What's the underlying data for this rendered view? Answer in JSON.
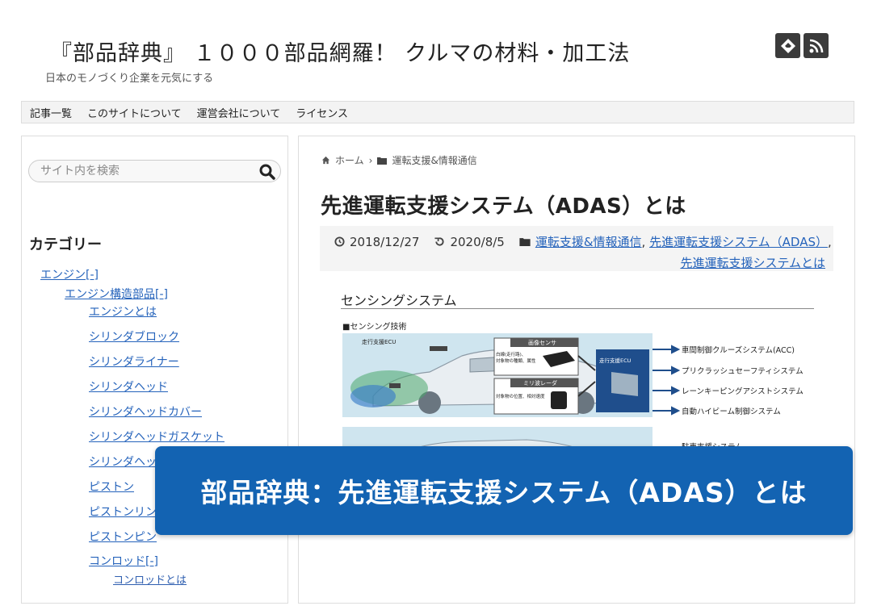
{
  "site": {
    "title": "『部品辞典』 １０００部品網羅！ クルマの材料・加工法",
    "description": "日本のモノづくり企業を元気にする"
  },
  "header_icons": [
    "feedly-icon",
    "rss-icon"
  ],
  "nav": [
    "記事一覧",
    "このサイトについて",
    "運営会社について",
    "ライセンス"
  ],
  "search": {
    "placeholder": "サイト内を検索"
  },
  "sidebar": {
    "category_title": "カテゴリー",
    "items": [
      "エンジン[-]",
      "エンジン構造部品[-]",
      "エンジンとは",
      "シリンダブロック",
      "シリンダライナー",
      "シリンダヘッド",
      "シリンダヘッドカバー",
      "シリンダヘッドガスケット",
      "シリンダヘッ",
      "ピストン",
      "ピストンリン",
      "ピストンピン",
      "コンロッド[-]",
      "コンロッドとは"
    ]
  },
  "breadcrumb": {
    "home": "ホーム",
    "separator": "›",
    "category": "運転支援&情報通信"
  },
  "article": {
    "title": "先進運転支援システム（ADAS）とは",
    "published": "2018/12/27",
    "updated": "2020/8/5",
    "categories": [
      "運転支援&情報通信",
      "先進運転支援システム（ADAS）",
      "先進運転支援システムとは"
    ],
    "category_separator": ","
  },
  "figure": {
    "title": "センシングシステム",
    "subtitle": "■センシング技術",
    "ecu_left": "走行支援ECU",
    "image_sensor": "画像センサ",
    "image_sensor_desc1": "白線(走行路)、",
    "image_sensor_desc2": "対象物の種類、属性",
    "radar": "ミリ波レーダ",
    "radar_desc": "対象物の位置、相対速度",
    "ecu_right": "走行支援ECU",
    "outputs": [
      "車間制御クルーズシステム(ACC)",
      "プリクラッシュセーフティシステム",
      "レーンキーピングアシストシステム",
      "自動ハイビーム制御システム"
    ],
    "partial_text": "駐車支援システム"
  },
  "banner": {
    "text": "部品辞典：先進運転支援システム（ADAS）とは"
  },
  "colors": {
    "link": "#2563bb",
    "banner": "#1363b2",
    "diagram_bg": "#cfe5ef",
    "ecu_box": "#1f4e8c"
  }
}
